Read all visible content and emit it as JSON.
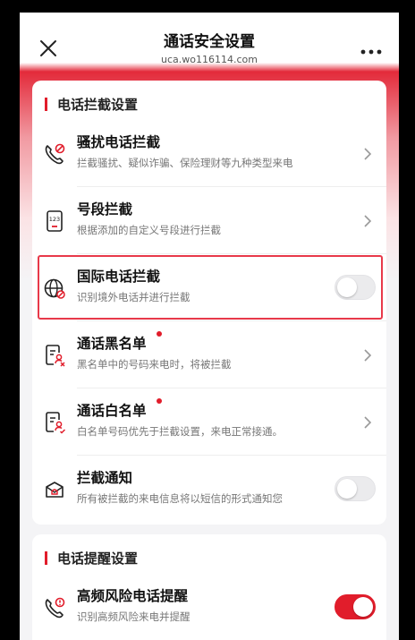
{
  "header": {
    "title": "通话安全设置",
    "subtitle": "uca.wo116114.com"
  },
  "sections": [
    {
      "title": "电话拦截设置",
      "items": [
        {
          "title": "骚扰电话拦截",
          "desc": "拦截骚扰、疑似诈骗、保险理财等九种类型来电",
          "control": "chevron",
          "icon": "phone-block-icon"
        },
        {
          "title": "号段拦截",
          "desc": "根据添加的自定义号段进行拦截",
          "control": "chevron",
          "icon": "number-range-icon"
        },
        {
          "title": "国际电话拦截",
          "desc": "识别境外电话并进行拦截",
          "control": "toggle",
          "on": false,
          "icon": "globe-block-icon",
          "highlighted": true
        },
        {
          "title": "通话黑名单",
          "desc": "黑名单中的号码来电时，将被拦截",
          "control": "chevron",
          "badge": true,
          "icon": "blacklist-icon"
        },
        {
          "title": "通话白名单",
          "desc": "白名单号码优先于拦截设置，来电正常接通。",
          "control": "chevron",
          "badge": true,
          "icon": "whitelist-icon"
        },
        {
          "title": "拦截通知",
          "desc": "所有被拦截的来电信息将以短信的形式通知您",
          "control": "toggle",
          "on": false,
          "icon": "notify-mail-icon"
        }
      ]
    },
    {
      "title": "电话提醒设置",
      "items": [
        {
          "title": "高频风险电话提醒",
          "desc": "识别高频风险来电并提醒",
          "control": "toggle",
          "on": true,
          "icon": "risk-phone-icon"
        }
      ]
    }
  ],
  "colors": {
    "accent": "#e11d2b",
    "text": "#111111",
    "muted": "#777777"
  }
}
